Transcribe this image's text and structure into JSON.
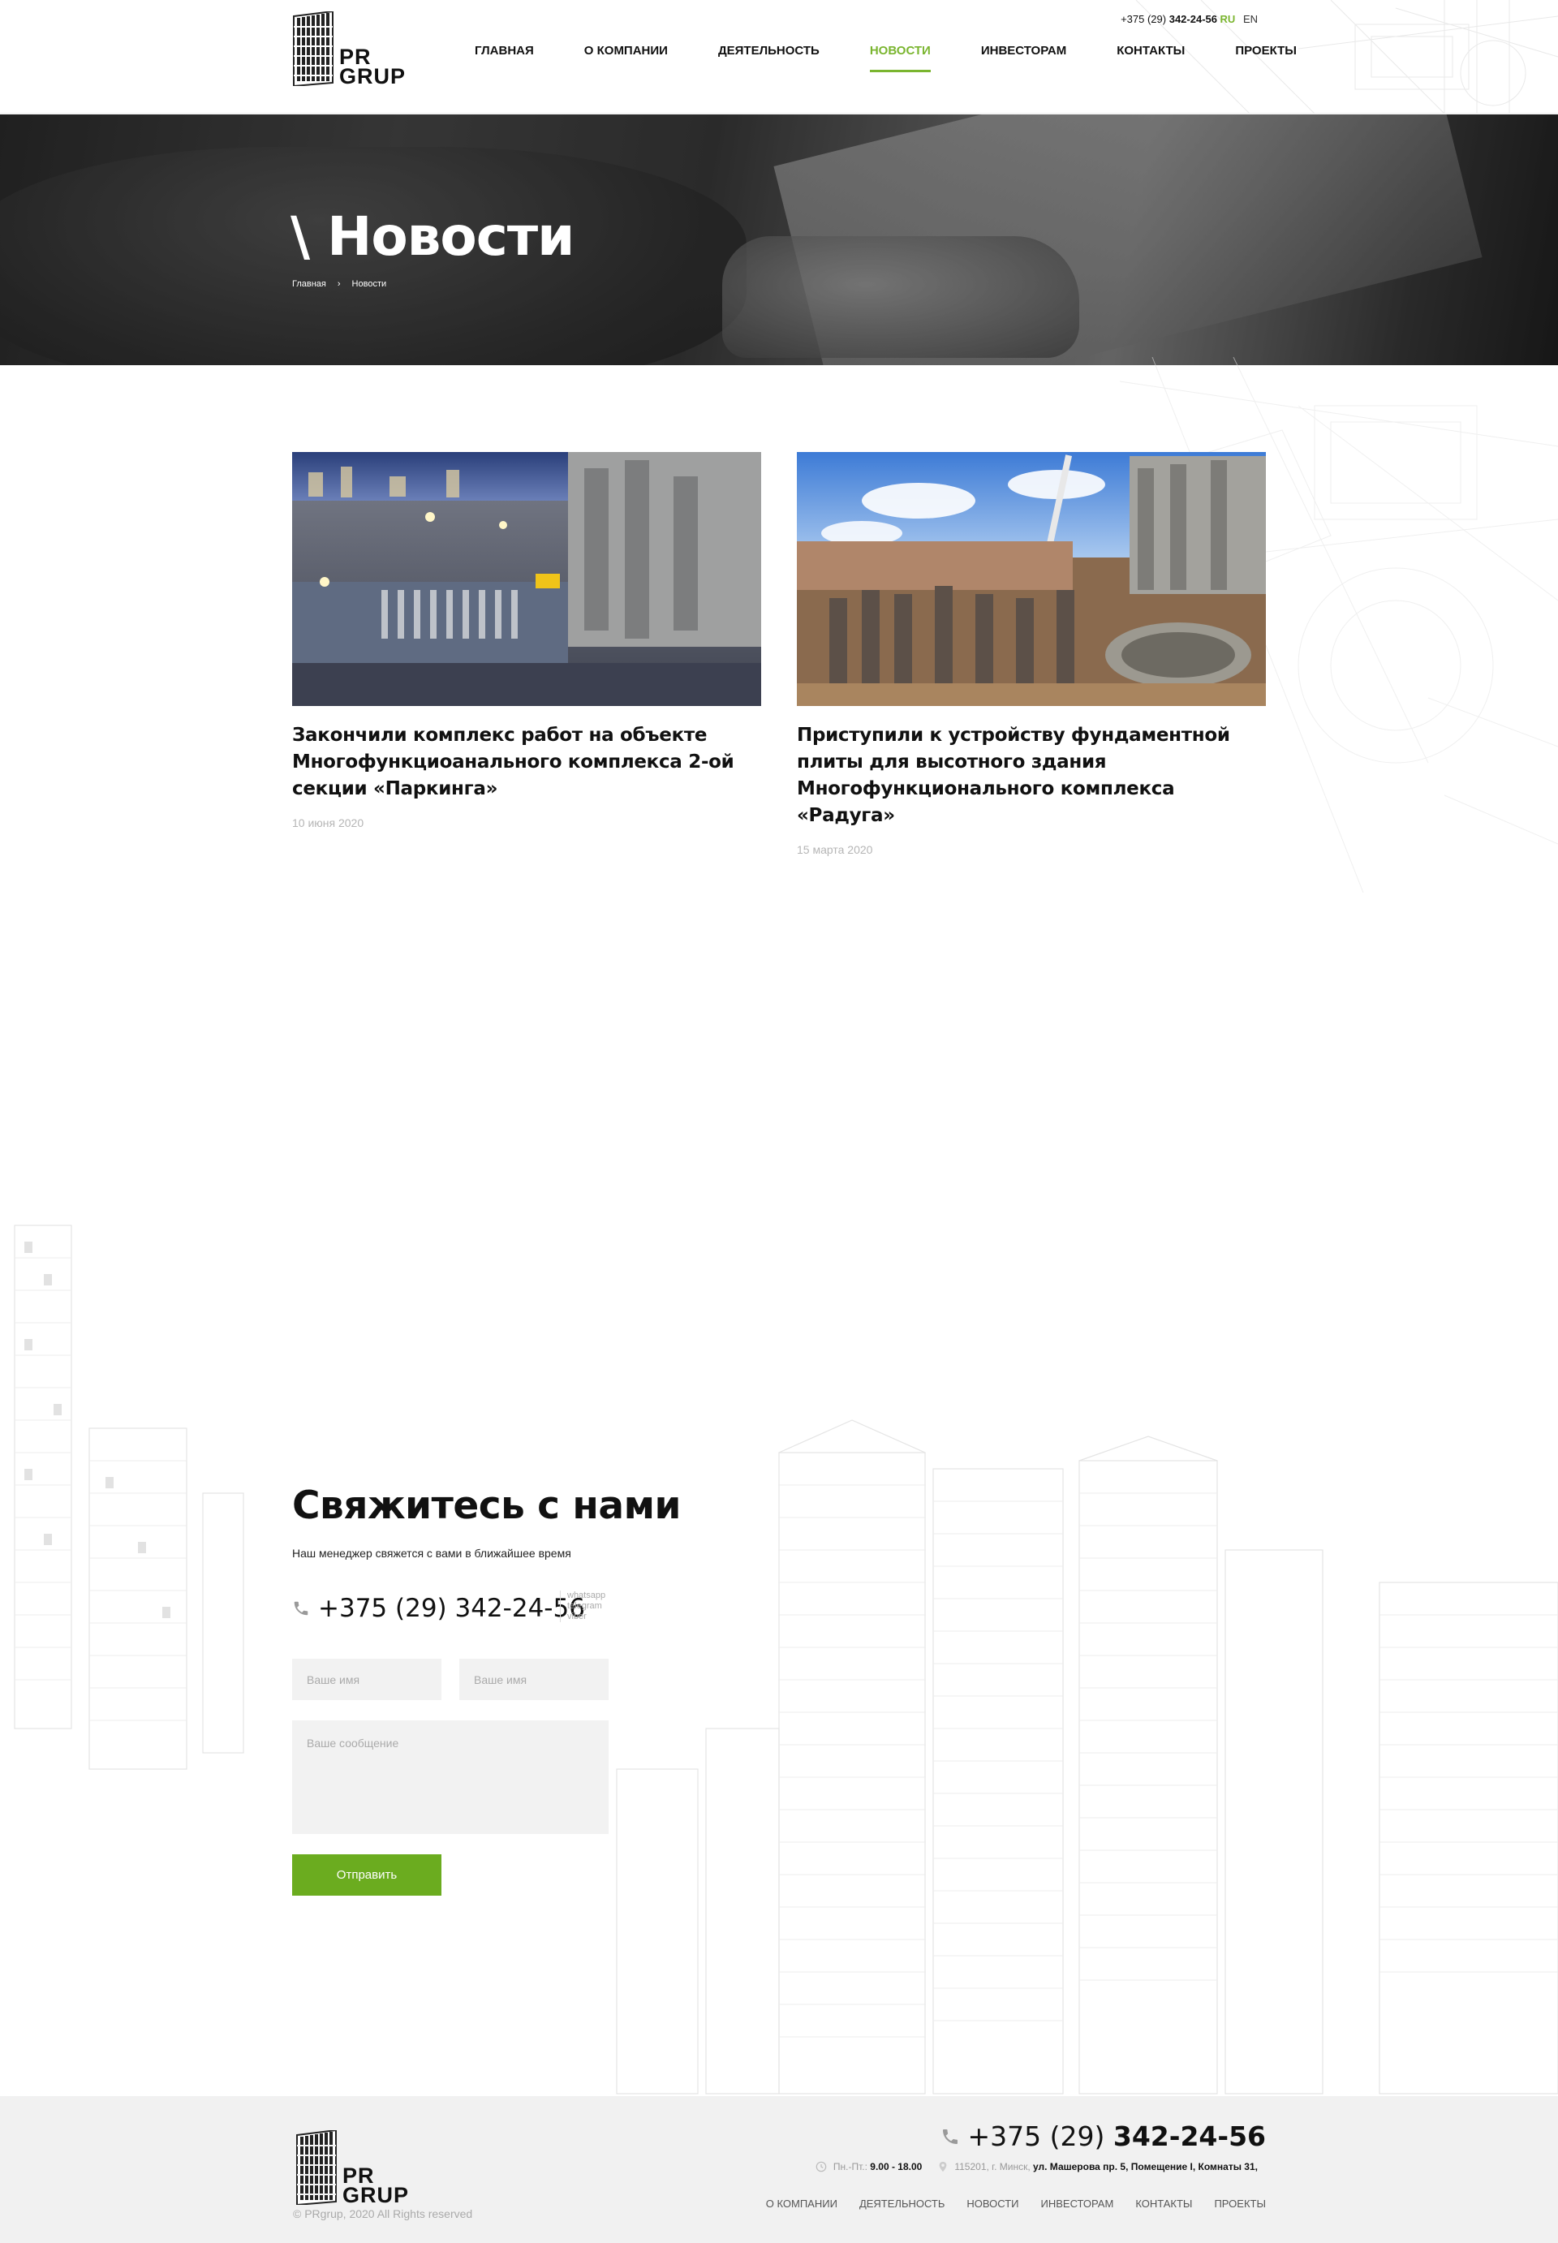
{
  "brand": {
    "name_line1": "PR",
    "name_line2": "GRUP"
  },
  "header": {
    "phone_prefix": "+375 (29)",
    "phone_number": "342-24-56",
    "lang_ru": "RU",
    "lang_en": "EN",
    "nav": [
      {
        "label": "Главная"
      },
      {
        "label": "О компании"
      },
      {
        "label": "Деятельность"
      },
      {
        "label": "Новости"
      },
      {
        "label": "Инвесторам"
      },
      {
        "label": "Контакты"
      },
      {
        "label": "Проекты"
      }
    ],
    "active_nav": "Новости"
  },
  "hero": {
    "title": "\\ Новости",
    "breadcrumb_home": "Главная",
    "breadcrumb_sep": "›",
    "breadcrumb_current": "Новости"
  },
  "news": [
    {
      "title": "Закончили комплекс работ на объекте Многофункциоанального комплекса 2-ой секции «Паркинга»",
      "date": "10 июня 2020"
    },
    {
      "title": "Приступили к устройству фундаментной плиты для высотного здания Многофункционального комплекса «Радуга»",
      "date": "15 марта 2020"
    }
  ],
  "contact": {
    "title": "Свяжитесь с нами",
    "subtitle": "Наш менеджер свяжется с вами в ближайшее время",
    "phone": "+375 (29) 342-24-56",
    "messengers": [
      "whatsapp",
      "telegram",
      "viber"
    ],
    "name_placeholder": "Ваше имя",
    "second_placeholder": "Ваше имя",
    "message_placeholder": "Ваше сообщение",
    "submit_label": "Отправить"
  },
  "footer": {
    "phone_prefix": "+375 (29)",
    "phone_number": "342-24-56",
    "hours_label": "Пн.-Пт.:",
    "hours_value": "9.00 - 18.00",
    "address_prefix": "115201, г. Минск,",
    "address_value": "ул. Машерова пр. 5, Помещение I, Комнаты 31,",
    "copyright": "© PRgrup, 2020 All Rights reserved",
    "nav": [
      {
        "label": "О компании"
      },
      {
        "label": "Деятельность"
      },
      {
        "label": "Новости"
      },
      {
        "label": "Инвесторам"
      },
      {
        "label": "Контакты"
      },
      {
        "label": "Проекты"
      }
    ]
  },
  "colors": {
    "accent": "#7ab52f",
    "button": "#6bac1f",
    "field_bg": "#f2f2f2",
    "footer_bg": "#f1f1f1"
  }
}
